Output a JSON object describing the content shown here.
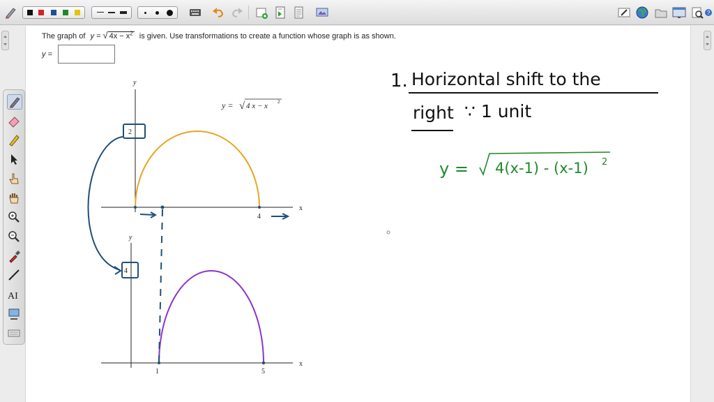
{
  "question": {
    "prefix": "The graph of",
    "y_eq": "y =",
    "radicand": "4x − x",
    "exp": "2",
    "suffix": "is given. Use transformations to create a function whose graph is as shown."
  },
  "answer": {
    "label": "y =",
    "value": ""
  },
  "top_graph": {
    "y_axis": "y",
    "x_axis": "x",
    "eq_lhs": "y =",
    "eq_radicand": "4 x − x",
    "eq_exp": "2",
    "tick_x": "4",
    "tick_y": "2"
  },
  "bottom_graph": {
    "y_axis": "y",
    "x_axis": "x",
    "tick_x1": "1",
    "tick_x2": "5",
    "tick_y": "4"
  },
  "notes": {
    "line1_num": "1.",
    "line1": "Horizontal   shift     to     the",
    "line2_a": "right",
    "line2_b": "∵   1  unit",
    "eq_lhs": "y =",
    "eq_rhs": "4(x-1) - (x-1)",
    "eq_exp": "2"
  },
  "colors": {
    "curve_top": "#e8a523",
    "curve_bottom": "#8b35c9",
    "ink_blue": "#1f4f7a",
    "ink_black": "#111111",
    "ink_green": "#1e8a2a"
  },
  "icons": {
    "toolbar": [
      "pen-tool-icon",
      "color-palette",
      "line-style-palette",
      "dot-size-palette",
      "keyboard-icon",
      "undo-icon",
      "redo-icon",
      "new-page-icon",
      "insert-page-icon",
      "page-icon",
      "screen-capture-icon",
      "edit-icon",
      "globe-icon",
      "folder-icon",
      "window-icon",
      "zoom-page-icon",
      "help-icon"
    ],
    "left_tools": [
      "pen-icon",
      "eraser-icon",
      "highlighter-icon",
      "select-arrow-icon",
      "pointer-hand-icon",
      "pan-hand-icon",
      "zoom-in-icon",
      "zoom-out-icon",
      "eyedropper-icon",
      "line-tool-icon",
      "text-tool-icon",
      "image-capture-icon",
      "keyboard-icon"
    ]
  }
}
